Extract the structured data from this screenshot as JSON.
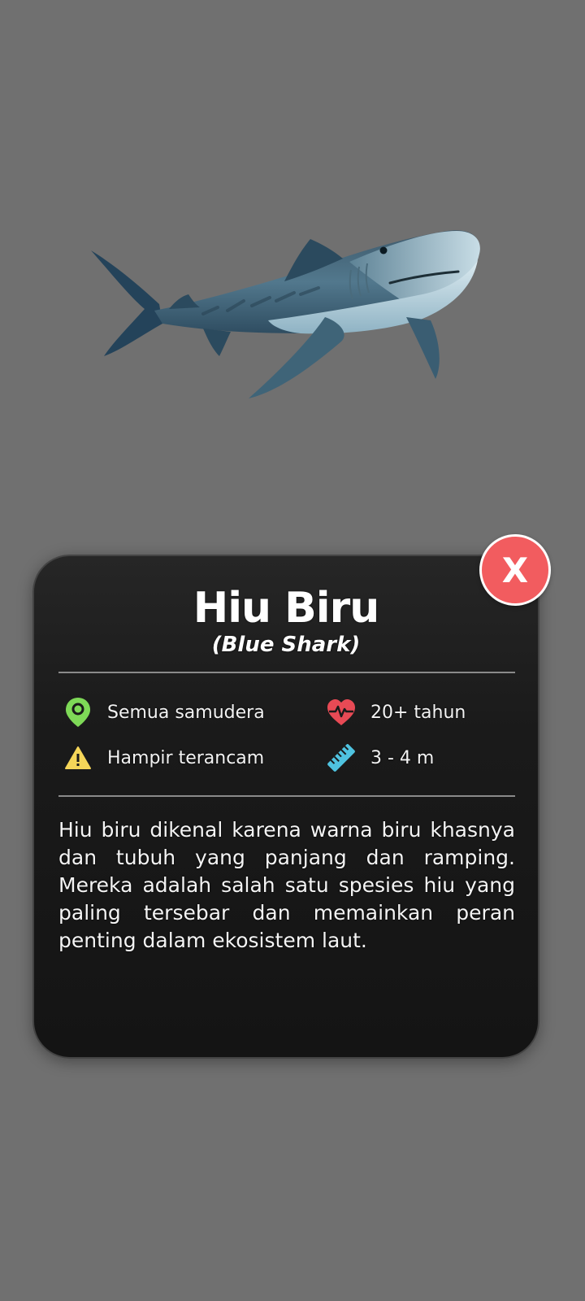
{
  "animal": {
    "name": "Hiu Biru",
    "scientific_name": "(Blue Shark)",
    "image_alt": "shark"
  },
  "close_button": {
    "label": "X"
  },
  "facts": {
    "habitat": "Semua samudera",
    "lifespan": "20+ tahun",
    "status": "Hampir terancam",
    "length": "3 - 4 m"
  },
  "description": "Hiu biru dikenal karena warna biru khasnya dan tubuh yang panjang dan ramping. Mereka adalah salah satu spesies hiu yang paling tersebar dan memainkan peran penting dalam ekosistem laut.",
  "icons": {
    "habitat": "map-pin-icon",
    "lifespan": "heartbeat-icon",
    "status": "warning-icon",
    "length": "ruler-icon"
  },
  "colors": {
    "background": "#707070",
    "card": "#1a1a1a",
    "close_button": "#f25c5f",
    "habitat_icon": "#7ed957",
    "lifespan_icon": "#e84a55",
    "status_icon": "#f5d659",
    "length_icon": "#4fc3e0"
  }
}
